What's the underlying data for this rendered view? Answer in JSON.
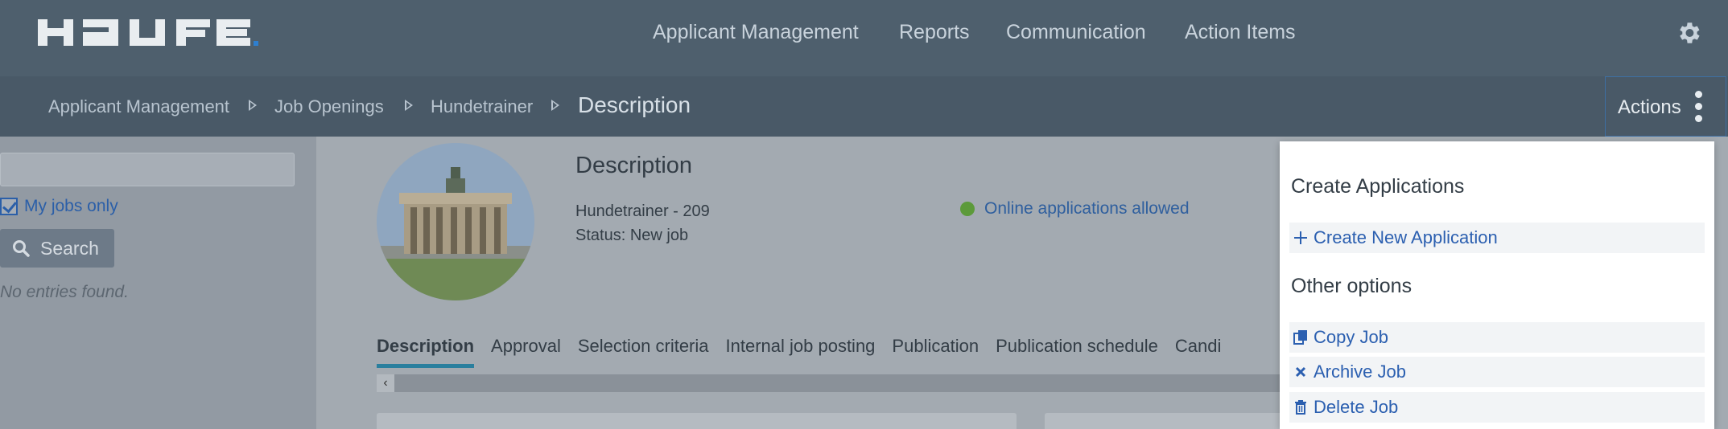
{
  "header": {
    "logo_text": "HAUFE",
    "nav": [
      "Applicant Management",
      "Reports",
      "Communication",
      "Action Items"
    ],
    "settings_icon": "gear-icon"
  },
  "breadcrumb": {
    "items": [
      "Applicant Management",
      "Job Openings",
      "Hundetrainer"
    ],
    "current": "Description",
    "actions_label": "Actions"
  },
  "sidebar": {
    "search_value": "",
    "my_jobs_label": "My jobs only",
    "my_jobs_checked": true,
    "search_button": "Search",
    "empty_text": "No entries found."
  },
  "job": {
    "title": "Description",
    "name_line": "Hundetrainer  - 209",
    "status_line": "Status: New job",
    "online_status": "Online applications allowed",
    "online_color": "#5c9a3a"
  },
  "tabs": [
    "Description",
    "Approval",
    "Selection criteria",
    "Internal job posting",
    "Publication",
    "Publication schedule",
    "Candi"
  ],
  "actions_menu": {
    "section1": "Create Applications",
    "create_new": "Create New Application",
    "section2": "Other options",
    "copy": "Copy Job",
    "archive": "Archive Job",
    "delete": "Delete Job"
  }
}
